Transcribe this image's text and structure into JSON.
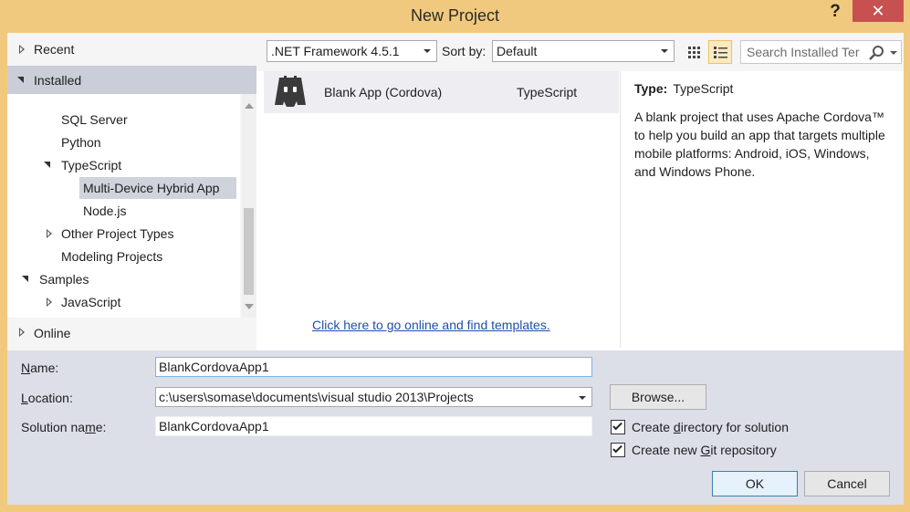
{
  "window": {
    "title": "New Project",
    "help": "?",
    "close": "✕"
  },
  "tree": {
    "recent": "Recent",
    "installed": "Installed",
    "items": [
      {
        "label": "SQL Server"
      },
      {
        "label": "Python"
      },
      {
        "label": "TypeScript"
      },
      {
        "label": "Multi-Device Hybrid App"
      },
      {
        "label": "Node.js"
      },
      {
        "label": "Other Project Types"
      },
      {
        "label": "Modeling Projects"
      },
      {
        "label": "Samples"
      },
      {
        "label": "JavaScript"
      }
    ],
    "online": "Online"
  },
  "toolbar": {
    "framework": ".NET Framework 4.5.1",
    "sort_label": "Sort by:",
    "sort_value": "Default",
    "search_placeholder": "Search Installed Ter"
  },
  "templates": [
    {
      "name": "Blank App (Cordova)",
      "language": "TypeScript"
    }
  ],
  "online_link": "Click here to go online and find templates.",
  "details": {
    "type_label": "Type:",
    "type_value": "TypeScript",
    "description": "A blank project that uses Apache Cordova™ to help you build an app that targets multiple mobile platforms: Android, iOS, Windows, and Windows Phone."
  },
  "form": {
    "name_label_pre": "N",
    "name_label_post": "ame:",
    "name_value": "BlankCordovaApp1",
    "location_label_pre": "L",
    "location_label_post": "ocation:",
    "location_value": "c:\\users\\somase\\documents\\visual studio 2013\\Projects",
    "solution_label_pre": "Solution na",
    "solution_label_u": "m",
    "solution_label_post": "e:",
    "solution_value": "BlankCordovaApp1",
    "browse": "Browse...",
    "create_dir_pre": "Create ",
    "create_dir_u": "d",
    "create_dir_post": "irectory for solution",
    "create_dir_checked": true,
    "create_git_pre": "Create new ",
    "create_git_u": "G",
    "create_git_post": "it repository",
    "create_git_checked": true,
    "ok": "OK",
    "cancel": "Cancel"
  }
}
